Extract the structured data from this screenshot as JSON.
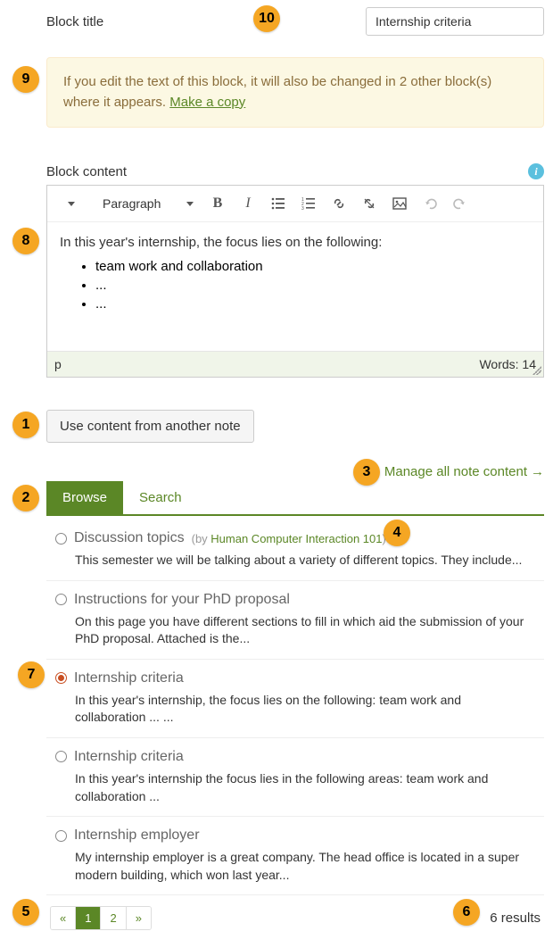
{
  "block_title": {
    "label": "Block title",
    "value": "Internship criteria"
  },
  "warning": {
    "text_prefix": "If you edit the text of this block, it will also be changed in 2 other block(s) where it appears. ",
    "link_text": "Make a copy"
  },
  "block_content": {
    "label": "Block content",
    "toolbar": {
      "paragraph": "Paragraph"
    },
    "intro": "In this year's internship, the focus lies on the following:",
    "items": [
      "team work and collaboration",
      "...",
      "..."
    ],
    "path": "p",
    "wordcount": "Words: 14"
  },
  "use_content_button": "Use content from another note",
  "manage_link": "Manage all note content",
  "tabs": {
    "browse": "Browse",
    "search": "Search"
  },
  "notes": [
    {
      "title": "Discussion topics",
      "author_prefix": "(by ",
      "author_name": "Human Computer Interaction 101",
      "author_suffix": ")",
      "desc": "This semester we will be talking about a variety of different topics. They include...",
      "selected": false
    },
    {
      "title": "Instructions for your PhD proposal",
      "desc": "On this page you have different sections to fill in which aid the submission of your PhD proposal. Attached is the...",
      "selected": false
    },
    {
      "title": "Internship criteria",
      "desc": "In this year's internship, the focus lies on the following: team work and collaboration ... ...",
      "selected": true
    },
    {
      "title": "Internship criteria",
      "desc": "In this year's internship the focus lies in the following areas: team work and collaboration ...",
      "selected": false
    },
    {
      "title": "Internship employer",
      "desc": "My internship employer is a great company. The head office is located in a super modern building, which won last year...",
      "selected": false
    }
  ],
  "pager": {
    "prev": "«",
    "pages": [
      "1",
      "2"
    ],
    "next": "»",
    "active": "1"
  },
  "results": "6 results",
  "markers": {
    "m1": "1",
    "m2": "2",
    "m3": "3",
    "m4": "4",
    "m5": "5",
    "m6": "6",
    "m7": "7",
    "m8": "8",
    "m9": "9",
    "m10": "10"
  }
}
